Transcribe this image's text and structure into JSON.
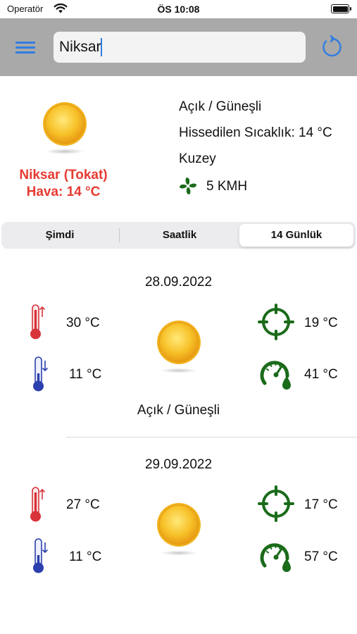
{
  "status_bar": {
    "carrier": "Operatör",
    "time": "ÖS 10:08"
  },
  "search": {
    "value": "Niksar"
  },
  "current": {
    "city": "Niksar (Tokat)",
    "temperature": "Hava: 14 °C",
    "condition": "Açık / Güneşli",
    "feels_like": "Hissedilen Sıcaklık: 14 °C",
    "wind_direction": "Kuzey",
    "wind_speed": "5 KMH"
  },
  "tabs": [
    {
      "label": "Şimdi",
      "selected": false
    },
    {
      "label": "Saatlik",
      "selected": false
    },
    {
      "label": "14 Günlük",
      "selected": true
    }
  ],
  "forecast": [
    {
      "date": "28.09.2022",
      "max_temp": "30 °C",
      "min_temp": "11 °C",
      "dew_point": "19 °C",
      "humidity": "41 °C",
      "condition": "Açık / Güneşli"
    },
    {
      "date": "29.09.2022",
      "max_temp": "27 °C",
      "min_temp": "11 °C",
      "dew_point": "17 °C",
      "humidity": "57 °C"
    }
  ],
  "colors": {
    "accent": "#2f7de1",
    "city_red": "#e63b32",
    "icon_green": "#1a6b1a",
    "hot_red": "#d8323a",
    "cold_blue": "#2b3fae",
    "navbar_gray": "#a9a9a9"
  },
  "icons": [
    "wifi-icon",
    "battery-icon",
    "menu-icon",
    "refresh-icon",
    "sun-icon",
    "wind-fan-icon",
    "thermometer-hot-icon",
    "thermometer-cold-icon",
    "crosshair-icon",
    "gauge-drop-icon"
  ]
}
